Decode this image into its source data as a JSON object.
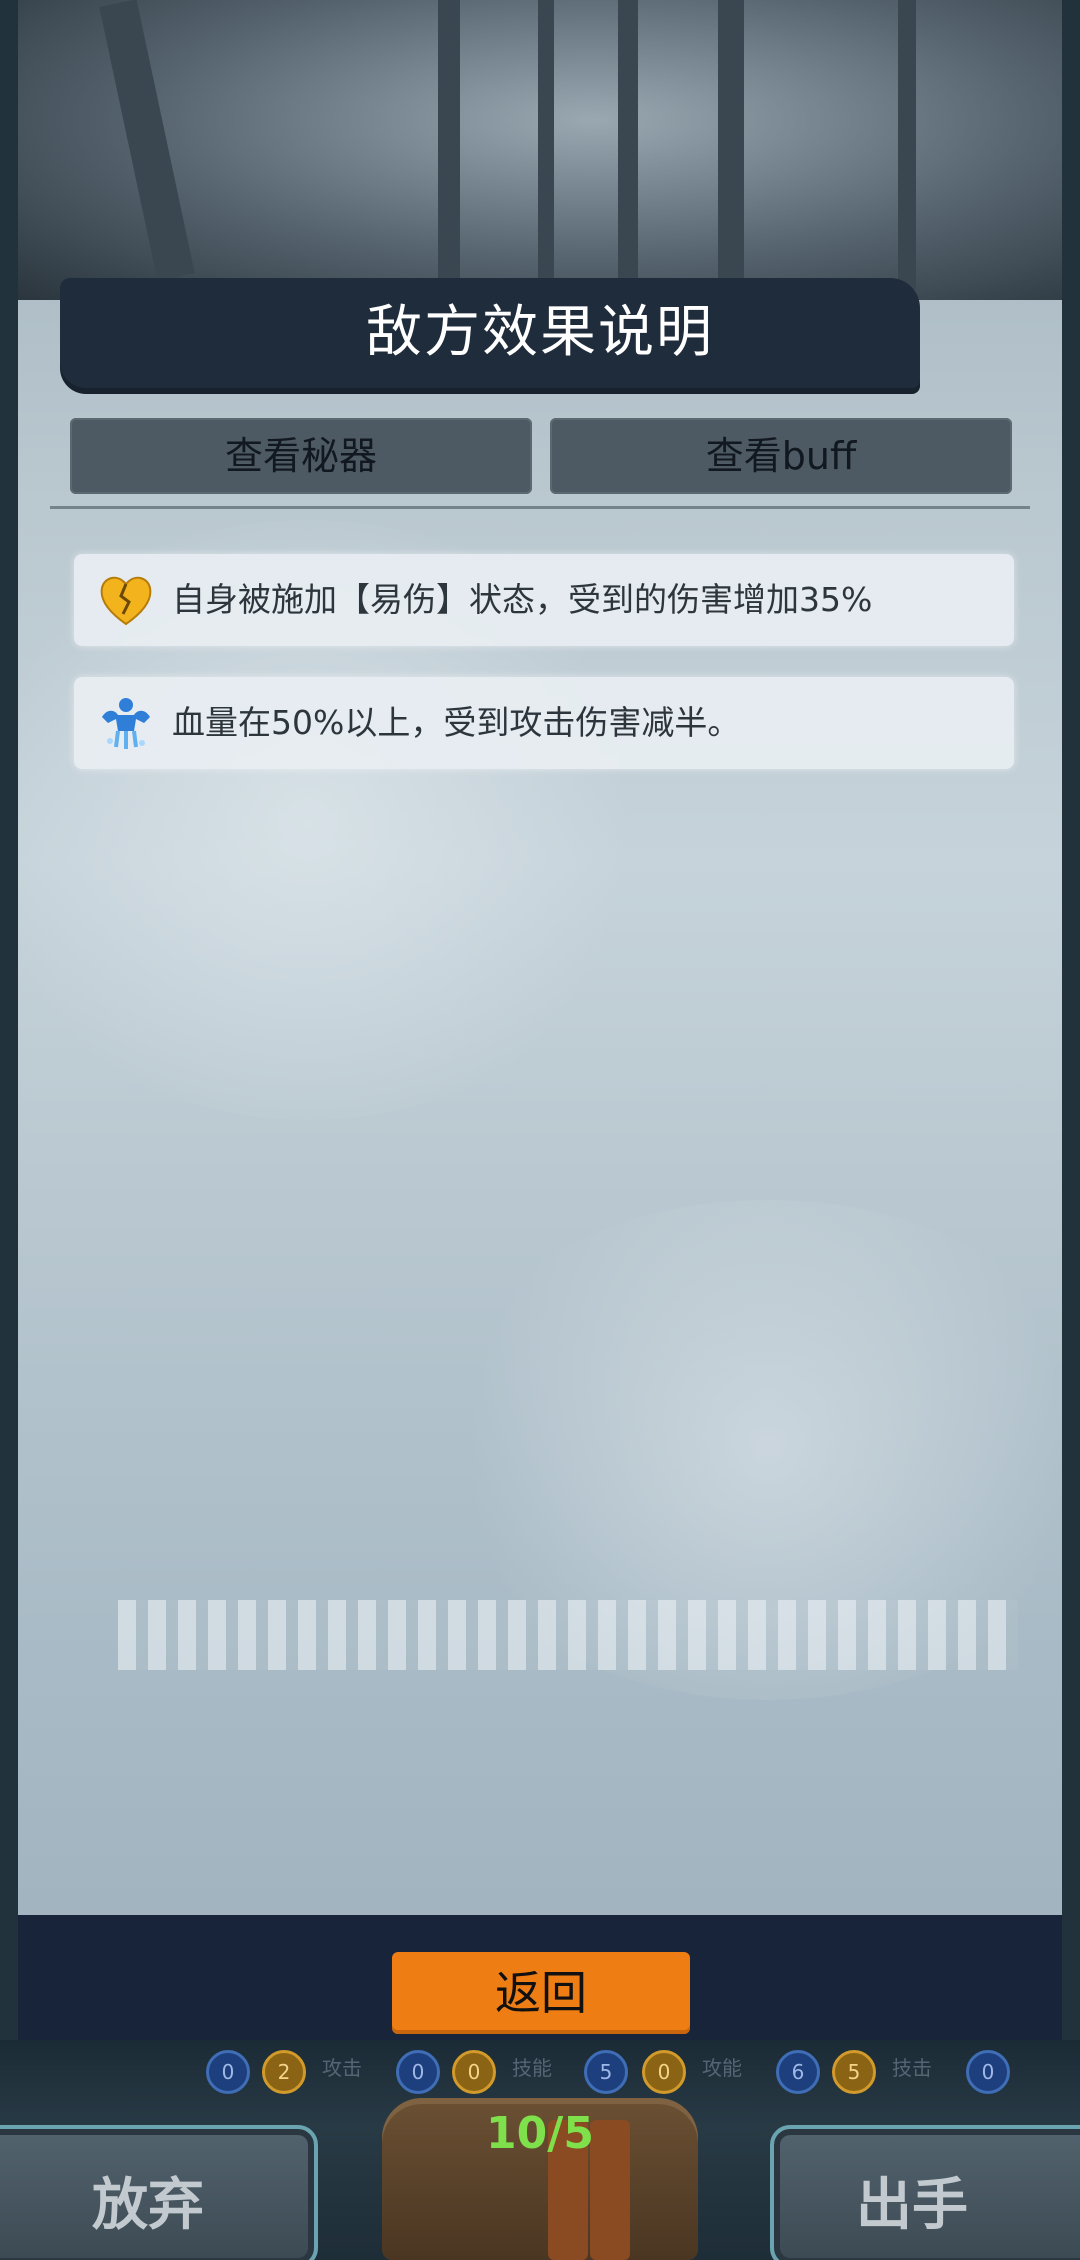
{
  "header": {
    "title": "敌方效果说明"
  },
  "tabs": [
    {
      "label": "查看秘器"
    },
    {
      "label": "查看buff"
    }
  ],
  "effects": [
    {
      "icon": "broken-heart-icon",
      "text": "自身被施加【易伤】状态，受到的伤害增加35%"
    },
    {
      "icon": "frozen-muscle-icon",
      "text": "血量在50%以上，受到攻击伤害减半。"
    }
  ],
  "actions": {
    "back_label": "返回"
  },
  "hud": {
    "card_count": "10/5",
    "give_up_label": "放弃",
    "play_label": "出手",
    "counters": [
      "0",
      "2",
      "0",
      "0",
      "5",
      "0",
      "6",
      "5",
      "0"
    ],
    "counter_labels": [
      "攻击",
      "技能",
      "攻能",
      "技击"
    ]
  },
  "colors": {
    "accent": "#ee7d14",
    "title_banner": "#1f2c3b",
    "count_text": "#7ee04a"
  }
}
